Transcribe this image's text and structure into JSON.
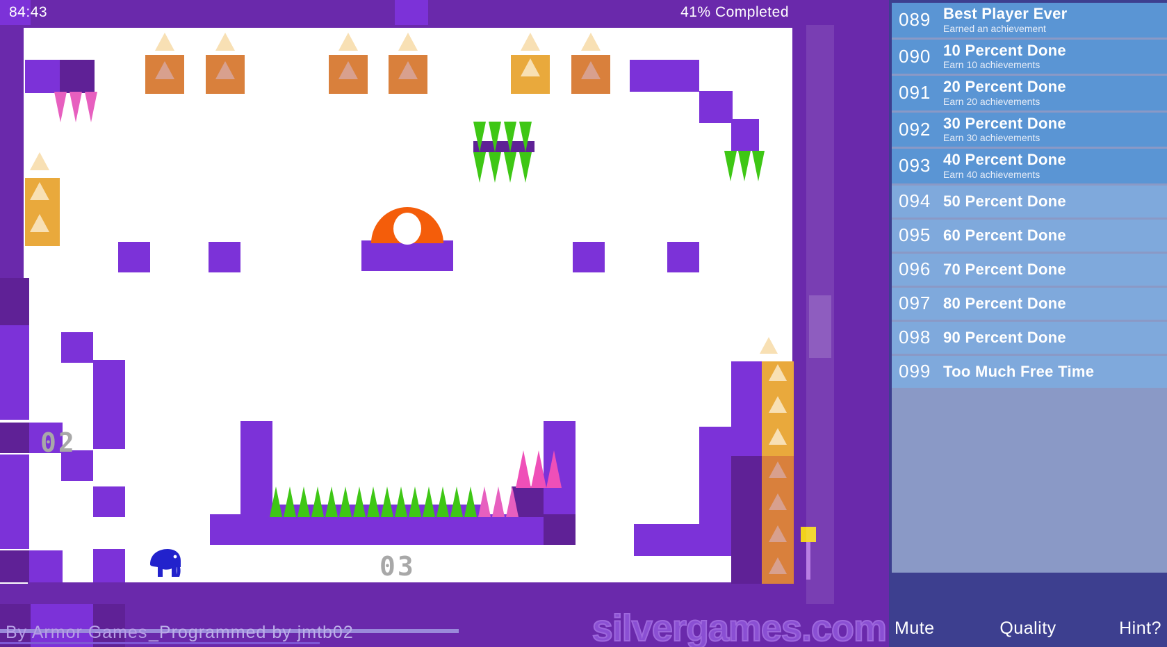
{
  "hud": {
    "timer": "84:43",
    "completed": "41% Completed",
    "credit_publisher": "By Armor Games",
    "credit_programmer": "_Programmed by jmtb02",
    "watermark": "silvergames.com"
  },
  "game": {
    "level_labels": [
      "02",
      "03"
    ],
    "player_icon": "elephant-sprite",
    "colors": {
      "bright_purple": "#7c32d8",
      "dark_purple": "#5f2196",
      "mid_purple": "#6a29ab",
      "sand_light": "#e9a93c",
      "sand_dark": "#d9803c",
      "spike_green": "#3ec715",
      "spike_pink": "#ef4fb8",
      "cannon_orange": "#f45d0a",
      "player_blue": "#2222cc",
      "flag_yellow": "#f2d21c"
    }
  },
  "panel": {
    "achievements": [
      {
        "id": "089",
        "title": "Best Player Ever",
        "desc": "Earned an achievement",
        "earned": true
      },
      {
        "id": "090",
        "title": "10 Percent Done",
        "desc": "Earn 10 achievements",
        "earned": true
      },
      {
        "id": "091",
        "title": "20 Percent Done",
        "desc": "Earn 20 achievements",
        "earned": true
      },
      {
        "id": "092",
        "title": "30 Percent Done",
        "desc": "Earn 30 achievements",
        "earned": true
      },
      {
        "id": "093",
        "title": "40 Percent Done",
        "desc": "Earn 40 achievements",
        "earned": true
      },
      {
        "id": "094",
        "title": "50 Percent Done",
        "desc": "",
        "earned": false
      },
      {
        "id": "095",
        "title": "60 Percent Done",
        "desc": "",
        "earned": false
      },
      {
        "id": "096",
        "title": "70 Percent Done",
        "desc": "",
        "earned": false
      },
      {
        "id": "097",
        "title": "80 Percent Done",
        "desc": "",
        "earned": false
      },
      {
        "id": "098",
        "title": "90 Percent Done",
        "desc": "",
        "earned": false
      },
      {
        "id": "099",
        "title": "Too Much Free Time",
        "desc": "",
        "earned": false
      }
    ],
    "buttons": {
      "mute": "Mute",
      "quality": "Quality",
      "hint": "Hint?"
    }
  }
}
